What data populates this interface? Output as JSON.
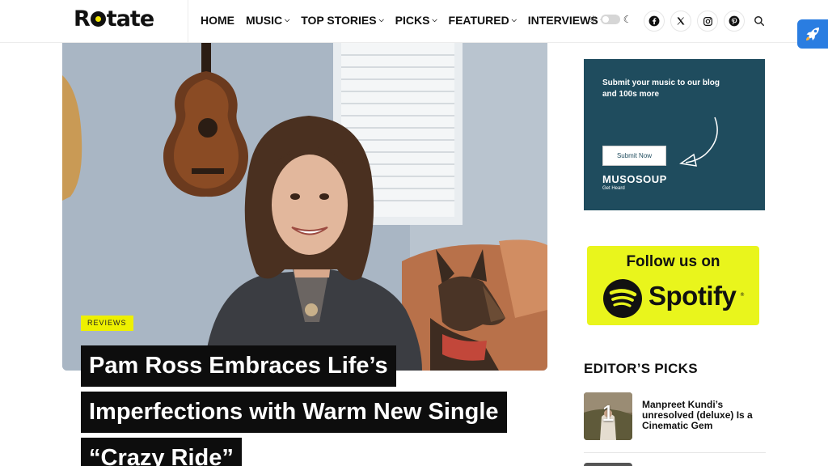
{
  "header": {
    "logo": {
      "pre": "R",
      "post": "tate"
    },
    "nav": [
      {
        "label": "HOME",
        "has_dropdown": false
      },
      {
        "label": "MUSIC",
        "has_dropdown": true
      },
      {
        "label": "TOP STORIES",
        "has_dropdown": true
      },
      {
        "label": "PICKS",
        "has_dropdown": true
      },
      {
        "label": "FEATURED",
        "has_dropdown": true
      },
      {
        "label": "INTERVIEWS",
        "has_dropdown": true
      }
    ],
    "theme_icons": [
      "sun-icon",
      "moon-icon"
    ],
    "social_icons": [
      "facebook-icon",
      "x-icon",
      "instagram-icon",
      "pinterest-icon"
    ],
    "search_icon": "search-icon"
  },
  "article": {
    "category": "REVIEWS",
    "headline_lines": [
      "Pam Ross Embraces Life’s",
      "Imperfections with Warm New Single",
      "“Crazy Ride”"
    ]
  },
  "sidebar": {
    "ad": {
      "text": "Submit your music to our blog and 100s more",
      "button": "Submit Now",
      "brand": "MUSOSOUP",
      "tagline": "Get Heard",
      "bg_color": "#1f4c5e"
    },
    "spotify": {
      "follow_text": "Follow us on",
      "brand": "Spotify",
      "reg": "®",
      "bg_color": "#e9f51c"
    },
    "editors_picks": {
      "heading": "EDITOR’S PICKS",
      "items": [
        {
          "number": "1",
          "title": "Manpreet Kundi’s unresolved (deluxe) Is a Cinematic Gem"
        }
      ]
    }
  },
  "floating_button": {
    "icon": "rocket-icon",
    "color": "#2a7de1"
  },
  "colors": {
    "accent": "#eef000",
    "headline_bg": "#0d0d0d"
  }
}
